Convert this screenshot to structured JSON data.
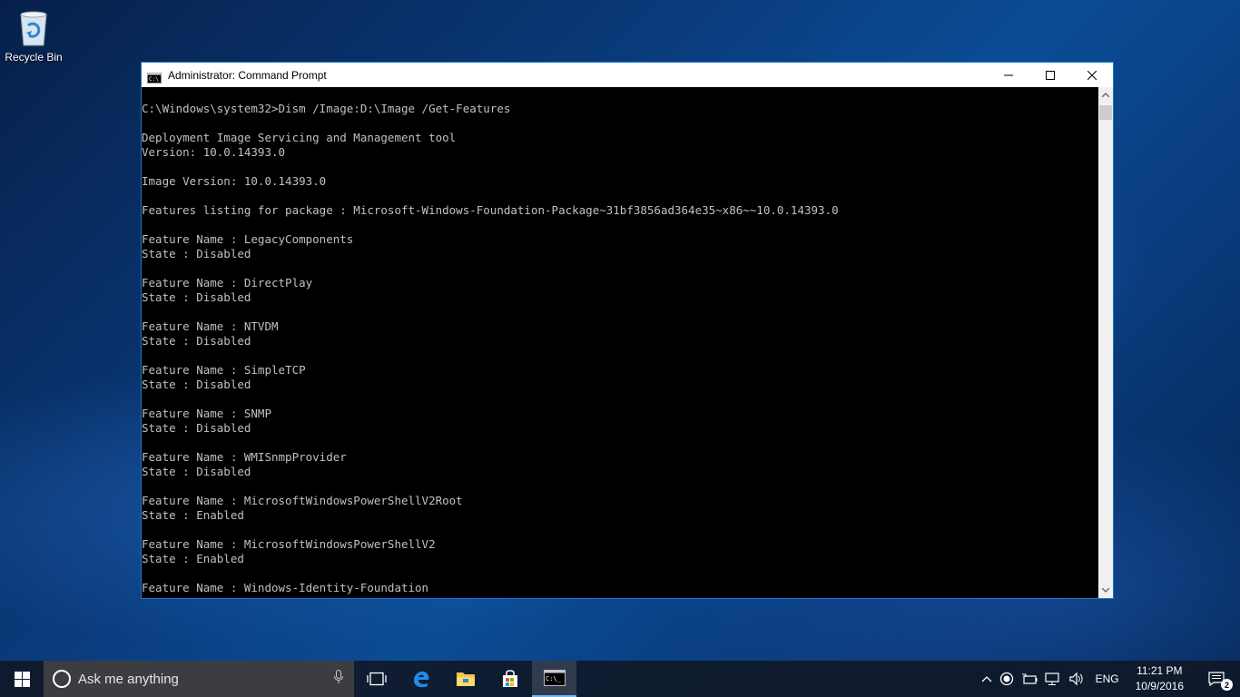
{
  "desktop": {
    "recycle_bin_label": "Recycle Bin"
  },
  "window": {
    "title": "Administrator: Command Prompt",
    "console_lines": [
      "C:\\Windows\\system32>Dism /Image:D:\\Image /Get-Features",
      "",
      "Deployment Image Servicing and Management tool",
      "Version: 10.0.14393.0",
      "",
      "Image Version: 10.0.14393.0",
      "",
      "Features listing for package : Microsoft-Windows-Foundation-Package~31bf3856ad364e35~x86~~10.0.14393.0",
      "",
      "Feature Name : LegacyComponents",
      "State : Disabled",
      "",
      "Feature Name : DirectPlay",
      "State : Disabled",
      "",
      "Feature Name : NTVDM",
      "State : Disabled",
      "",
      "Feature Name : SimpleTCP",
      "State : Disabled",
      "",
      "Feature Name : SNMP",
      "State : Disabled",
      "",
      "Feature Name : WMISnmpProvider",
      "State : Disabled",
      "",
      "Feature Name : MicrosoftWindowsPowerShellV2Root",
      "State : Enabled",
      "",
      "Feature Name : MicrosoftWindowsPowerShellV2",
      "State : Enabled",
      "",
      "Feature Name : Windows-Identity-Foundation"
    ]
  },
  "taskbar": {
    "search_placeholder": "Ask me anything",
    "language": "ENG",
    "time": "11:21 PM",
    "date": "10/9/2016",
    "notification_count": "2"
  }
}
